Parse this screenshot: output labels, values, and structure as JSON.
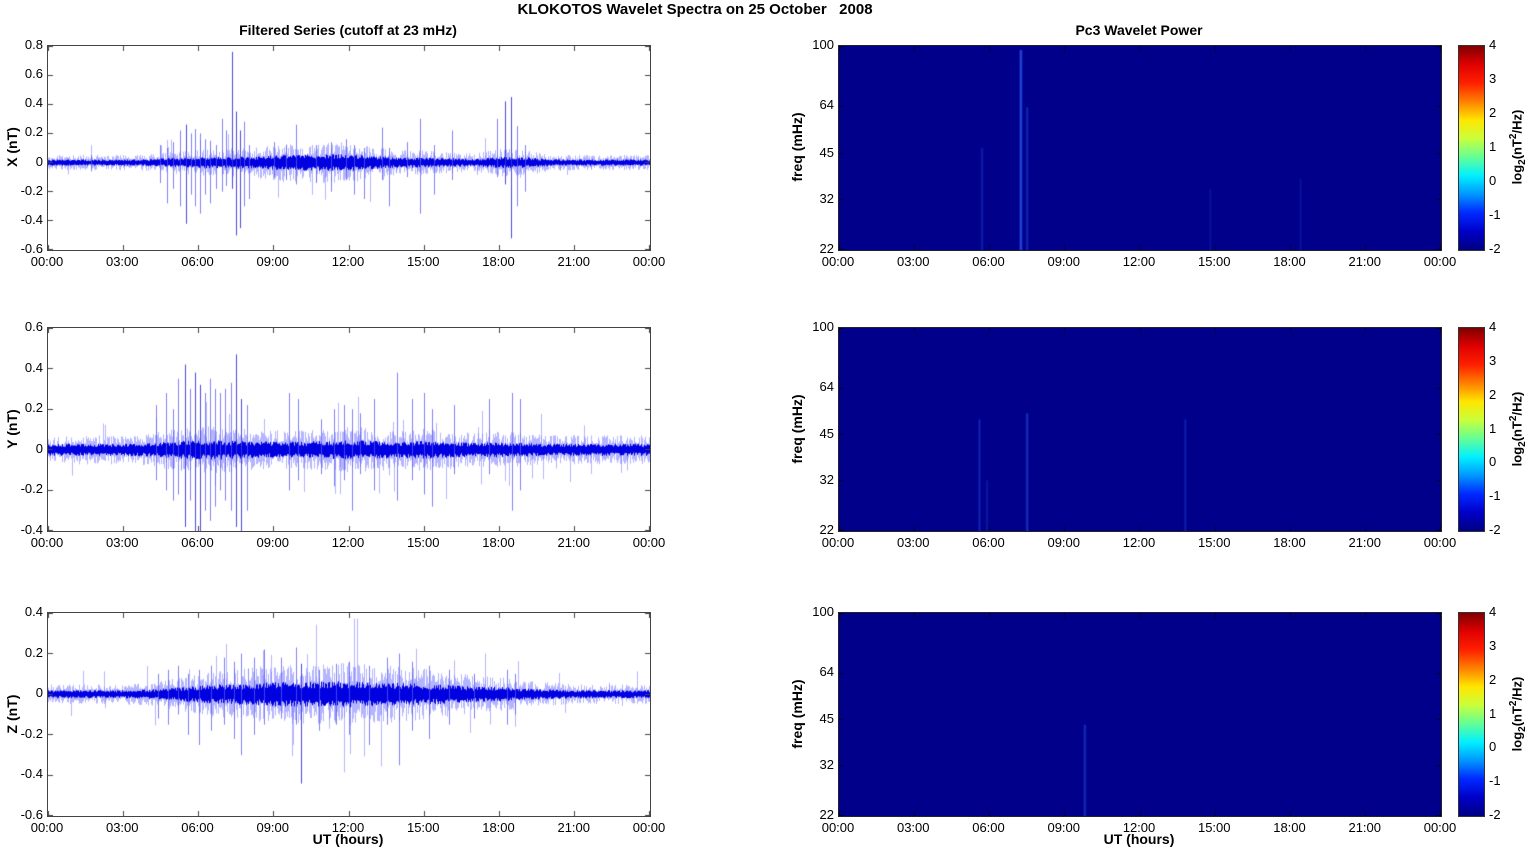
{
  "figure": {
    "title": "KLOKOTOS Wavelet Spectra on 25 October   2008"
  },
  "columns": {
    "left_title": "Filtered Series (cutoff at 23 mHz)",
    "right_title": "Pc3 Wavelet Power",
    "x_axis_label": "UT (hours)",
    "x_tick_labels": [
      "00:00",
      "03:00",
      "06:00",
      "09:00",
      "12:00",
      "15:00",
      "18:00",
      "21:00",
      "00:00"
    ]
  },
  "colorbar": {
    "tick_labels": [
      "4",
      "3",
      "2",
      "1",
      "0",
      "-1",
      "-2"
    ],
    "label_prefix": "log",
    "label_sub": "2",
    "label_mid": "(nT",
    "label_sup": "2",
    "label_suffix": "/Hz)",
    "colormap": "jet",
    "gradient_top_to_bottom": [
      "#7f0000",
      "#e00000",
      "#ff2000",
      "#ff8000",
      "#ffe600",
      "#c8ff3c",
      "#64ff96",
      "#00f0ff",
      "#0096ff",
      "#0028ff",
      "#0000c8",
      "#000082"
    ]
  },
  "chart_data": [
    {
      "type": "line",
      "panel": "X filtered series",
      "title": "Filtered Series (cutoff at 23 mHz)",
      "ylabel": "X (nT)",
      "ylim": [
        -0.6,
        0.8
      ],
      "ytick_labels": [
        "0.8",
        "0.6",
        "0.4",
        "0.2",
        "0",
        "-0.2",
        "-0.4",
        "-0.6"
      ],
      "x_range_hours": [
        0,
        24
      ],
      "line_color": "#0000ee",
      "noise_envelope_by_hour": [
        0.022,
        0.022,
        0.022,
        0.022,
        0.024,
        0.032,
        0.038,
        0.04,
        0.042,
        0.05,
        0.055,
        0.058,
        0.058,
        0.045,
        0.035,
        0.035,
        0.03,
        0.026,
        0.04,
        0.038,
        0.024,
        0.022,
        0.022,
        0.022,
        0.022
      ],
      "spikes_t_up_down": [
        [
          1.7,
          0.05,
          0.06
        ],
        [
          4.45,
          0.12,
          0.14
        ],
        [
          4.75,
          0.1,
          0.28
        ],
        [
          5.0,
          0.14,
          0.18
        ],
        [
          5.25,
          0.22,
          0.3
        ],
        [
          5.5,
          0.26,
          0.42
        ],
        [
          5.7,
          0.2,
          0.22
        ],
        [
          5.85,
          0.23,
          0.3
        ],
        [
          6.05,
          0.2,
          0.35
        ],
        [
          6.25,
          0.16,
          0.22
        ],
        [
          6.45,
          0.15,
          0.28
        ],
        [
          6.7,
          0.12,
          0.18
        ],
        [
          6.95,
          0.3,
          0.2
        ],
        [
          7.1,
          0.22,
          0.16
        ],
        [
          7.35,
          0.76,
          0.18
        ],
        [
          7.5,
          0.35,
          0.5
        ],
        [
          7.65,
          0.22,
          0.45
        ],
        [
          7.8,
          0.28,
          0.3
        ],
        [
          8.0,
          0.12,
          0.25
        ],
        [
          9.0,
          0.14,
          0.1
        ],
        [
          9.5,
          0.12,
          0.12
        ],
        [
          9.9,
          0.26,
          0.15
        ],
        [
          10.7,
          0.12,
          0.14
        ],
        [
          11.3,
          0.14,
          0.2
        ],
        [
          11.9,
          0.16,
          0.12
        ],
        [
          12.2,
          0.12,
          0.22
        ],
        [
          12.6,
          0.1,
          0.25
        ],
        [
          13.3,
          0.24,
          0.12
        ],
        [
          13.6,
          0.1,
          0.3
        ],
        [
          14.3,
          0.14,
          0.1
        ],
        [
          14.85,
          0.3,
          0.35
        ],
        [
          15.4,
          0.12,
          0.22
        ],
        [
          16.1,
          0.22,
          0.12
        ],
        [
          17.9,
          0.3,
          0.1
        ],
        [
          18.2,
          0.42,
          0.15
        ],
        [
          18.45,
          0.45,
          0.52
        ],
        [
          18.7,
          0.25,
          0.3
        ],
        [
          19.0,
          0.12,
          0.2
        ]
      ]
    },
    {
      "type": "heatmap",
      "panel": "X Pc3 wavelet power",
      "title": "Pc3 Wavelet Power",
      "ylabel": "freq (mHz)",
      "yscale": "log",
      "ylim_mhz": [
        22,
        100
      ],
      "ytick_labels": [
        "100",
        "64",
        "45",
        "32",
        "22"
      ],
      "x_range_hours": [
        0,
        24
      ],
      "background_power_log2": -2,
      "background_color": "#00008a",
      "colorbar_range_log2": [
        -2,
        4
      ],
      "streaks": [
        {
          "t": 5.7,
          "from_frac": 0.5,
          "to_frac": 1.0,
          "alpha": 0.25
        },
        {
          "t": 7.25,
          "from_frac": 0.02,
          "to_frac": 1.0,
          "alpha": 0.8
        },
        {
          "t": 7.5,
          "from_frac": 0.3,
          "to_frac": 1.0,
          "alpha": 0.35
        },
        {
          "t": 14.8,
          "from_frac": 0.7,
          "to_frac": 1.0,
          "alpha": 0.15
        },
        {
          "t": 18.4,
          "from_frac": 0.65,
          "to_frac": 1.0,
          "alpha": 0.15
        }
      ]
    },
    {
      "type": "line",
      "panel": "Y filtered series",
      "ylabel": "Y (nT)",
      "ylim": [
        -0.4,
        0.6
      ],
      "ytick_labels": [
        "0.6",
        "0.4",
        "0.2",
        "0",
        "-0.2",
        "-0.4"
      ],
      "x_range_hours": [
        0,
        24
      ],
      "line_color": "#0000ee",
      "noise_envelope_by_hour": [
        0.03,
        0.03,
        0.03,
        0.03,
        0.034,
        0.042,
        0.048,
        0.048,
        0.042,
        0.04,
        0.04,
        0.044,
        0.048,
        0.044,
        0.04,
        0.044,
        0.04,
        0.034,
        0.038,
        0.034,
        0.03,
        0.03,
        0.03,
        0.03,
        0.03
      ],
      "spikes_t_up_down": [
        [
          4.3,
          0.22,
          0.15
        ],
        [
          4.7,
          0.28,
          0.2
        ],
        [
          5.0,
          0.2,
          0.25
        ],
        [
          5.2,
          0.35,
          0.22
        ],
        [
          5.45,
          0.42,
          0.38
        ],
        [
          5.65,
          0.3,
          0.25
        ],
        [
          5.85,
          0.38,
          0.45
        ],
        [
          6.05,
          0.32,
          0.42
        ],
        [
          6.25,
          0.28,
          0.3
        ],
        [
          6.45,
          0.35,
          0.35
        ],
        [
          6.65,
          0.3,
          0.28
        ],
        [
          6.85,
          0.28,
          0.2
        ],
        [
          7.05,
          0.3,
          0.25
        ],
        [
          7.3,
          0.33,
          0.3
        ],
        [
          7.5,
          0.47,
          0.38
        ],
        [
          7.7,
          0.25,
          0.42
        ],
        [
          7.95,
          0.22,
          0.3
        ],
        [
          9.6,
          0.28,
          0.2
        ],
        [
          9.95,
          0.25,
          0.15
        ],
        [
          10.9,
          0.15,
          0.12
        ],
        [
          11.4,
          0.2,
          0.18
        ],
        [
          11.8,
          0.22,
          0.15
        ],
        [
          12.1,
          0.2,
          0.3
        ],
        [
          12.45,
          0.18,
          0.12
        ],
        [
          13.0,
          0.25,
          0.2
        ],
        [
          13.9,
          0.38,
          0.25
        ],
        [
          14.5,
          0.25,
          0.15
        ],
        [
          15.0,
          0.28,
          0.22
        ],
        [
          15.3,
          0.2,
          0.28
        ],
        [
          16.2,
          0.22,
          0.12
        ],
        [
          17.6,
          0.25,
          0.12
        ],
        [
          18.5,
          0.28,
          0.3
        ],
        [
          18.8,
          0.25,
          0.2
        ]
      ]
    },
    {
      "type": "heatmap",
      "panel": "Y Pc3 wavelet power",
      "ylabel": "freq (mHz)",
      "yscale": "log",
      "ylim_mhz": [
        22,
        100
      ],
      "ytick_labels": [
        "100",
        "64",
        "45",
        "32",
        "22"
      ],
      "x_range_hours": [
        0,
        24
      ],
      "background_power_log2": -2,
      "background_color": "#00008a",
      "colorbar_range_log2": [
        -2,
        4
      ],
      "streaks": [
        {
          "t": 5.6,
          "from_frac": 0.45,
          "to_frac": 1.0,
          "alpha": 0.3
        },
        {
          "t": 5.9,
          "from_frac": 0.75,
          "to_frac": 1.0,
          "alpha": 0.2
        },
        {
          "t": 7.5,
          "from_frac": 0.42,
          "to_frac": 1.0,
          "alpha": 0.45
        },
        {
          "t": 13.8,
          "from_frac": 0.45,
          "to_frac": 1.0,
          "alpha": 0.25
        }
      ]
    },
    {
      "type": "line",
      "panel": "Z filtered series",
      "ylabel": "Z (nT)",
      "xlabel": "UT (hours)",
      "ylim": [
        -0.6,
        0.4
      ],
      "ytick_labels": [
        "0.4",
        "0.2",
        "0",
        "-0.2",
        "-0.4",
        "-0.6"
      ],
      "x_range_hours": [
        0,
        24
      ],
      "line_color": "#0000ee",
      "noise_envelope_by_hour": [
        0.02,
        0.02,
        0.02,
        0.02,
        0.024,
        0.032,
        0.042,
        0.05,
        0.055,
        0.06,
        0.062,
        0.062,
        0.065,
        0.06,
        0.058,
        0.052,
        0.046,
        0.038,
        0.036,
        0.028,
        0.024,
        0.02,
        0.02,
        0.02,
        0.02
      ],
      "spikes_t_up_down": [
        [
          4.4,
          0.1,
          0.12
        ],
        [
          4.8,
          0.12,
          0.15
        ],
        [
          5.2,
          0.14,
          0.1
        ],
        [
          5.6,
          0.1,
          0.2
        ],
        [
          6.0,
          0.12,
          0.25
        ],
        [
          6.5,
          0.14,
          0.18
        ],
        [
          7.0,
          0.18,
          0.15
        ],
        [
          7.4,
          0.16,
          0.22
        ],
        [
          7.7,
          0.2,
          0.3
        ],
        [
          8.2,
          0.18,
          0.2
        ],
        [
          8.6,
          0.22,
          0.15
        ],
        [
          9.3,
          0.18,
          0.12
        ],
        [
          9.9,
          0.23,
          0.15
        ],
        [
          10.1,
          0.15,
          0.44
        ],
        [
          10.8,
          0.12,
          0.18
        ],
        [
          11.5,
          0.15,
          0.15
        ],
        [
          12.0,
          0.16,
          0.2
        ],
        [
          12.8,
          0.14,
          0.25
        ],
        [
          13.5,
          0.18,
          0.15
        ],
        [
          14.0,
          0.2,
          0.35
        ],
        [
          14.5,
          0.16,
          0.18
        ],
        [
          15.2,
          0.14,
          0.22
        ],
        [
          16.0,
          0.12,
          0.15
        ],
        [
          17.0,
          0.1,
          0.12
        ],
        [
          18.3,
          0.12,
          0.15
        ],
        [
          18.6,
          0.1,
          0.1
        ]
      ]
    },
    {
      "type": "heatmap",
      "panel": "Z Pc3 wavelet power",
      "ylabel": "freq (mHz)",
      "xlabel": "UT (hours)",
      "yscale": "log",
      "ylim_mhz": [
        22,
        100
      ],
      "ytick_labels": [
        "100",
        "64",
        "45",
        "32",
        "22"
      ],
      "x_range_hours": [
        0,
        24
      ],
      "background_power_log2": -2,
      "background_color": "#00008a",
      "colorbar_range_log2": [
        -2,
        4
      ],
      "streaks": [
        {
          "t": 9.8,
          "from_frac": 0.55,
          "to_frac": 1.0,
          "alpha": 0.4
        }
      ]
    }
  ]
}
